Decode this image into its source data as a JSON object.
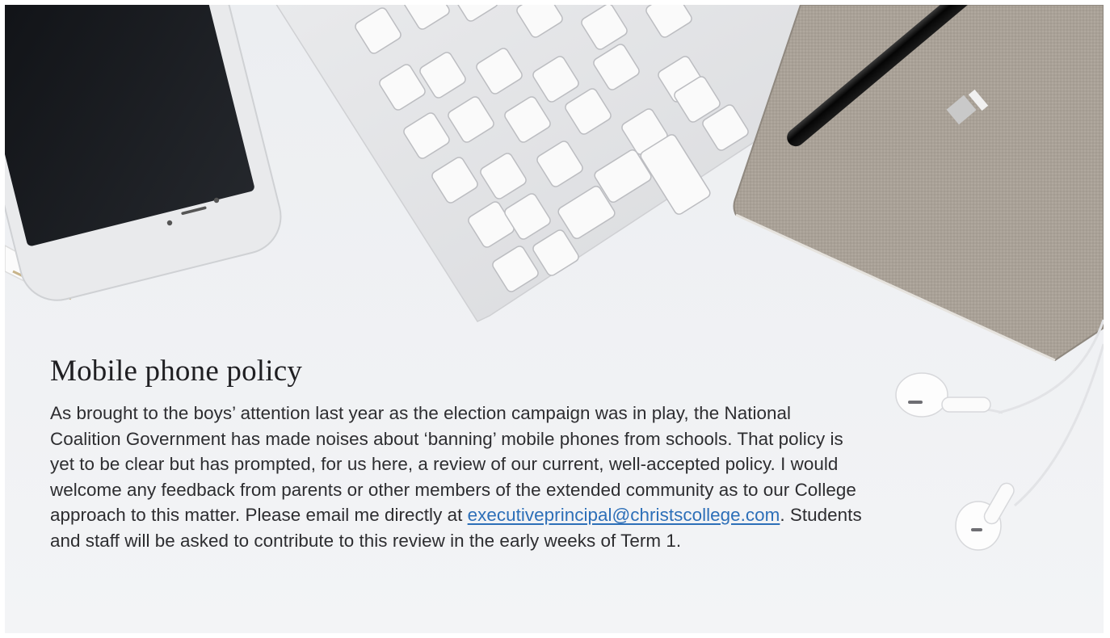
{
  "article": {
    "heading": "Mobile phone policy",
    "paragraph_before_link": "As brought to the boys’ attention last year as the election campaign was in play, the National Coalition Government has made noises about ‘banning’ mobile phones from schools. That policy is yet to be clear but has prompted, for us here, a review of our current, well-accepted policy. I would welcome any feedback from parents or other members of the extended community as to our College approach to this matter. Please email me directly at ",
    "email": "executiveprincipal@christscollege.com",
    "email_href": "mailto:executiveprincipal@christscollege.com",
    "paragraph_after_link": ". Students and staff will be asked to contribute to this review in the early weeks of Term 1."
  },
  "theme": {
    "background": "#f1f2f4",
    "heading_color": "#1f1f22",
    "text_color": "#2d2d30",
    "link_color": "#2d6fb8"
  },
  "hero_image": {
    "objects": [
      "smartphone",
      "wireless-keyboard",
      "fabric-notebook",
      "fountain-pen",
      "earphones",
      "white-pen"
    ]
  }
}
